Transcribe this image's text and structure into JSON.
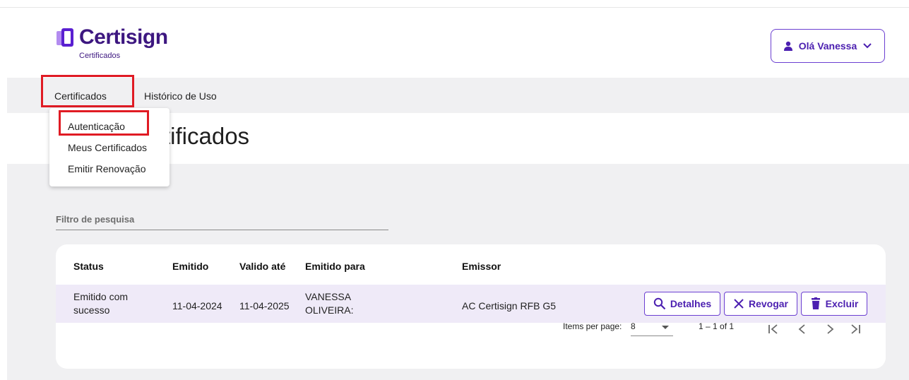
{
  "header": {
    "brand": "Certisign",
    "brand_sub": "Certificados",
    "user_greeting": "Olá Vanessa"
  },
  "nav": {
    "items": [
      {
        "label": "Certificados"
      },
      {
        "label": "Histórico de Uso"
      }
    ]
  },
  "dropdown": {
    "items": [
      {
        "label": "Autenticação"
      },
      {
        "label": "Meus Certificados"
      },
      {
        "label": "Emitir Renovação"
      }
    ]
  },
  "page_title": "tificados",
  "filter": {
    "label": "Filtro de pesquisa"
  },
  "table": {
    "columns": [
      "Status",
      "Emitido",
      "Valido até",
      "Emitido para",
      "Emissor"
    ],
    "rows": [
      {
        "status_line1": "Emitido com",
        "status_line2": "sucesso",
        "emitido": "11-04-2024",
        "valido_ate": "11-04-2025",
        "para_line1": "VANESSA",
        "para_line2": "OLIVEIRA:",
        "emissor": "AC Certisign RFB G5",
        "actions": [
          "Detalhes",
          "Revogar",
          "Excluir"
        ]
      }
    ]
  },
  "pagination": {
    "items_per_page_label": "Items per page:",
    "items_per_page_value": "8",
    "range": "1 – 1 of 1"
  },
  "colors": {
    "brand": "#3d1780",
    "accent": "#6b3fd1",
    "highlight": "#e01b24",
    "row_selected": "#efeaf8"
  },
  "icons": [
    "certisign-logo-icon",
    "user-icon",
    "chevron-down-icon",
    "search-icon",
    "close-icon",
    "trash-icon",
    "first-page-icon",
    "prev-page-icon",
    "next-page-icon",
    "last-page-icon",
    "dropdown-arrow-icon"
  ]
}
